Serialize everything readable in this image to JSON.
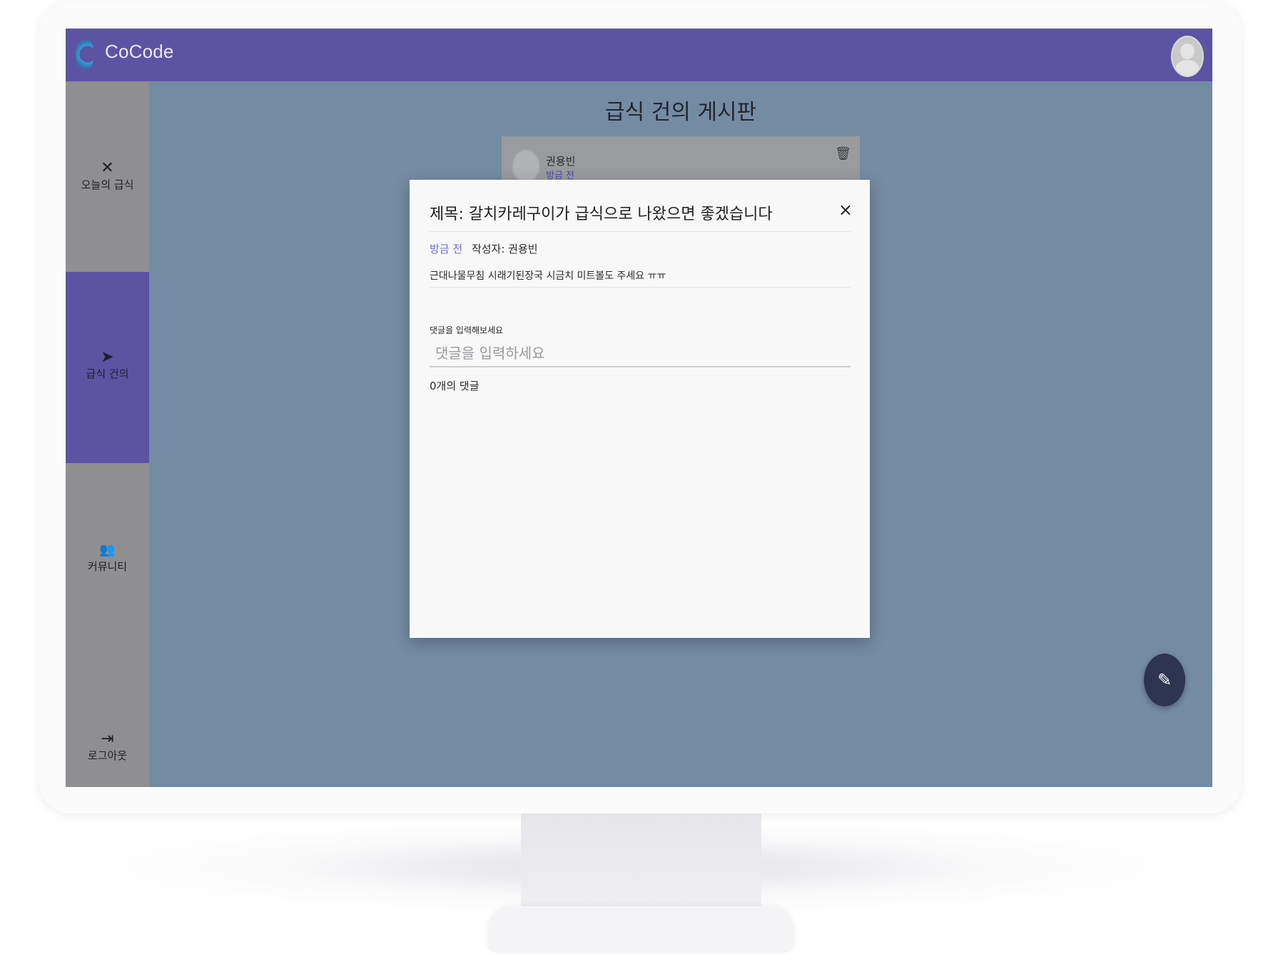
{
  "app": {
    "name": "CoCode"
  },
  "sidebar": {
    "items": [
      {
        "label": "오늘의 급식",
        "icon": "utensils-icon"
      },
      {
        "label": "급식 건의",
        "icon": "paper-plane-icon"
      },
      {
        "label": "커뮤니티",
        "icon": "people-icon"
      },
      {
        "label": "로그아웃",
        "icon": "logout-icon"
      }
    ],
    "active_index": 1
  },
  "board": {
    "title": "급식 건의 게시판",
    "card_author": "권용빈",
    "card_status": "방금 전"
  },
  "modal": {
    "title": "제목: 갈치카레구이가 급식으로 나왔으면 좋겠습니다",
    "close_symbol": "×",
    "status": "방금 전",
    "author_line": "작성자: 권용빈",
    "body": "근대나물무침 시래기된장국 시금치 미트볼도 주세요 ㅠㅠ",
    "comment_label": "댓글을 입력해보세요",
    "comment_placeholder": "댓글을 입력하세요",
    "comment_value": "",
    "comment_count": "0개의 댓글"
  },
  "colors": {
    "header": "#5c54a3",
    "sidebar": "#8f8f91",
    "overlay": "#748ba4",
    "status_link": "#6e6bd4",
    "fab": "#2d3553"
  }
}
